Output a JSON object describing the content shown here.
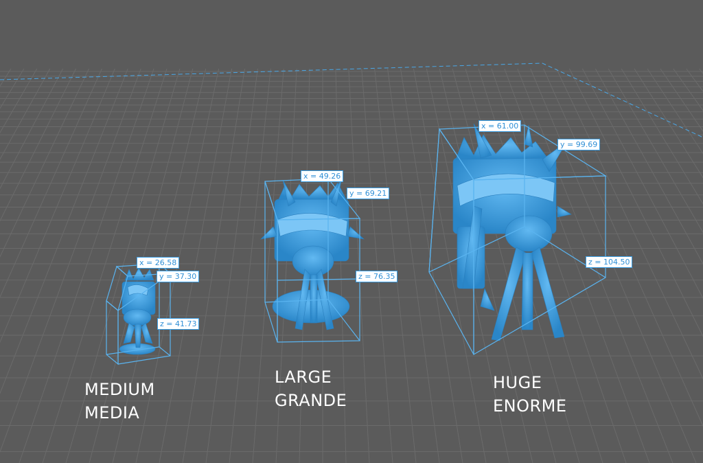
{
  "colors": {
    "background": "#5b5b5b",
    "grid_line": "#6b6b6b",
    "bed_edge": "#4aa8e8",
    "model_blue": "#3d9fe0",
    "bbox": "#5ab4f0",
    "label_text": "#2f8fd6",
    "caption_text": "#ffffff"
  },
  "models": [
    {
      "name": "medium",
      "dims": {
        "x": "x = 26.58",
        "y": "y = 37.30",
        "z": "z = 41.73"
      },
      "caption": {
        "line1": "MEDIUM",
        "line2": "MEDIA"
      }
    },
    {
      "name": "large",
      "dims": {
        "x": "x = 49.26",
        "y": "y = 69.21",
        "z": "z = 76.35"
      },
      "caption": {
        "line1": "LARGE",
        "line2": "GRANDE"
      }
    },
    {
      "name": "huge",
      "dims": {
        "x": "x = 61.00",
        "y": "y = 99.69",
        "z": "z = 104.50"
      },
      "caption": {
        "line1": "HUGE",
        "line2": "ENORME"
      }
    }
  ]
}
